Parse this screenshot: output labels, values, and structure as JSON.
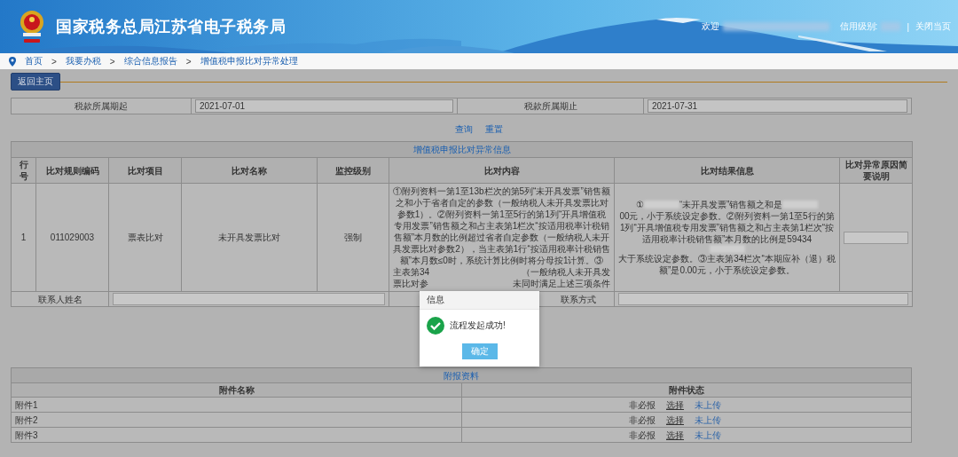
{
  "header": {
    "title": "国家税务总局江苏省电子税务局",
    "welcome": "欢迎",
    "credit_label": "信用级别:",
    "separator": "|",
    "close_link": "关闭当页"
  },
  "breadcrumb": [
    {
      "label": "首页"
    },
    {
      "separator": ">",
      "label": "我要办税"
    },
    {
      "separator": ">",
      "label": "综合信息报告"
    },
    {
      "separator": ">",
      "label": "增值税申报比对异常处理"
    }
  ],
  "back_button": "返回主页",
  "period": [
    {
      "label": "税款所属期起",
      "value": "2021-07-01"
    },
    {
      "label": "税款所属期止",
      "value": "2021-07-31"
    }
  ],
  "actions": [
    "查询",
    "重置"
  ],
  "compare_table": {
    "title": "增值税申报比对异常信息",
    "columns": [
      "行号",
      "比对规则编码",
      "比对项目",
      "比对名称",
      "监控级别",
      "比对内容",
      "比对结果信息",
      "比对异常原因简要说明"
    ],
    "rows": [
      {
        "row_no": "1",
        "rule_code": "011029003",
        "item": "票表比对",
        "name": "未开具发票比对",
        "level": "强制",
        "content": {
          "text": "①附列资料一第1至13b栏次的第5列“未开具发票”销售额之和小于省者自定的参数（一般纳税人未开具发票比对参数1）。②附列资料一第1至5行的第1列“开具增值税专用发票”销售额之和占主表第1栏次“按适用税率计税销售额”本月数的比例超过省者自定参数（一般纳税人未开具发票比对参数2），当主表第1行“按适用税率计税销售额”本月数≤0时，系统计算比例时将分母按1计算。③",
          "fragments": [
            {
              "left": "主表第34",
              "right": "（一般纳税人未开具发"
            },
            {
              "left": "票比对参",
              "right": "未同时满足上述三项条件"
            }
          ]
        },
        "result": [
          {
            "kind": "text",
            "text": "①"
          },
          {
            "kind": "blur"
          },
          {
            "kind": "text",
            "text": "“未开具发票”销售额之和是"
          },
          {
            "kind": "blur"
          },
          {
            "kind": "text",
            "text": "00元，小于系统设定参数。②附列资料一第1至5行的第1列“开具增值税专用发票”销售额之和占主表第1栏次“按适用税率计税销售额”本月数的比例是59434"
          },
          {
            "kind": "blur"
          },
          {
            "kind": "text",
            "text": "大于系统设定参数。③主表第34栏次“本期应补（退）税额”是0.00元，小于系统设定参数。"
          }
        ]
      }
    ]
  },
  "contact": [
    {
      "label": "联系人姓名"
    },
    {
      "label": "联系方式"
    }
  ],
  "attachments": {
    "title": "附报资料",
    "columns": [
      "附件名称",
      "附件状态"
    ],
    "rows": [
      {
        "name": "附件1",
        "requirement": "非必报",
        "select_link": "选择",
        "status": "未上传"
      },
      {
        "name": "附件2",
        "requirement": "非必报",
        "select_link": "选择",
        "status": "未上传"
      },
      {
        "name": "附件3",
        "requirement": "非必报",
        "select_link": "选择",
        "status": "未上传"
      }
    ]
  },
  "dialog": {
    "title": "信息",
    "message": "流程发起成功!",
    "button": "确定"
  }
}
